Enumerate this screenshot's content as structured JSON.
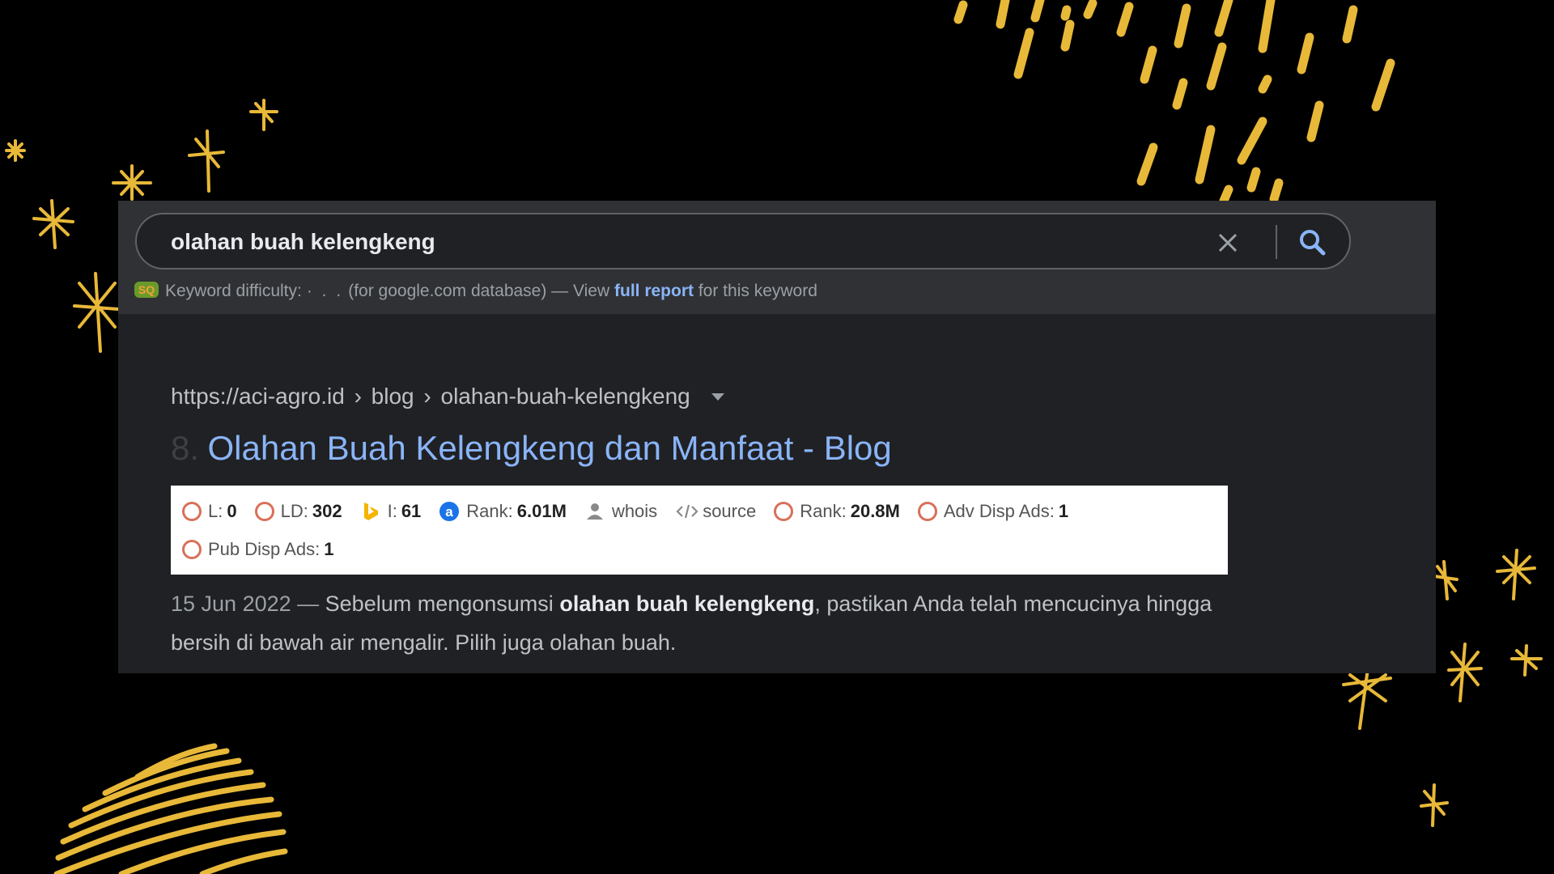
{
  "search": {
    "query": "olahan buah kelengkeng",
    "clear_icon": "close-icon",
    "search_icon": "search-icon"
  },
  "keyword_difficulty": {
    "logo_text": "SQ",
    "label": "Keyword difficulty:",
    "dots": "· . .",
    "database_text": "(for google.com database) — View",
    "link_text": "full report",
    "suffix": "for this keyword"
  },
  "result": {
    "url": {
      "domain": "https://aci-agro.id",
      "crumb1": "blog",
      "crumb2": "olahan-buah-kelengkeng",
      "separator": "›"
    },
    "rank_number": "8.",
    "title": "Olahan Buah Kelengkeng dan Manfaat - Blog",
    "metrics": {
      "l_label": "L:",
      "l_value": "0",
      "ld_label": "LD:",
      "ld_value": "302",
      "i_label": "I:",
      "i_value": "61",
      "alexa_label": "Rank:",
      "alexa_value": "6.01M",
      "whois_label": "whois",
      "source_label": "source",
      "rank2_label": "Rank:",
      "rank2_value": "20.8M",
      "adv_label": "Adv Disp Ads:",
      "adv_value": "1",
      "pub_label": "Pub Disp Ads:",
      "pub_value": "1"
    },
    "snippet": {
      "date": "15 Jun 2022 —",
      "pre": "Sebelum mengonsumsi",
      "bold": "olahan buah kelengkeng",
      "post": ", pastikan Anda telah mencucinya hingga bersih di bawah air mengalir. Pilih juga olahan buah."
    }
  },
  "colors": {
    "background": "#000000",
    "panel": "#202124",
    "strip": "#303134",
    "link": "#8ab4f8",
    "gold": "#e8b838",
    "metric_circle": "#d9705a"
  }
}
